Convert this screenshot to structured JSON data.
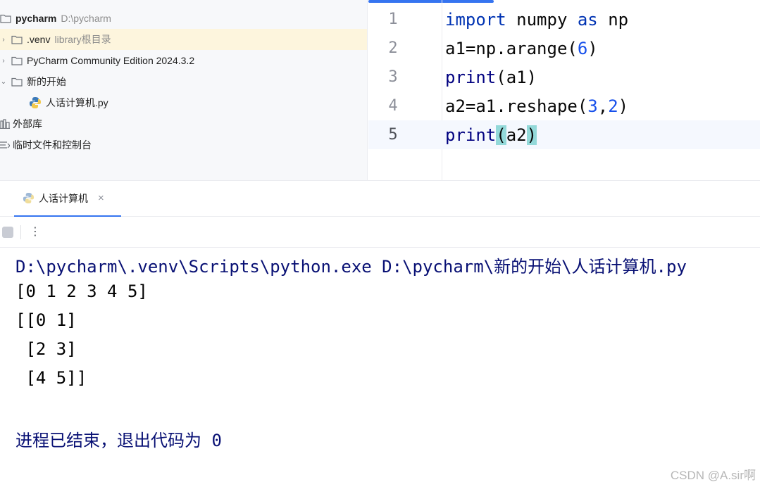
{
  "project": {
    "root_name": "pycharm",
    "root_path": "D:\\pycharm",
    "items": [
      {
        "label": ".venv",
        "hint": "library根目录"
      },
      {
        "label": "PyCharm Community Edition 2024.3.2"
      },
      {
        "label": "新的开始"
      },
      {
        "label": "人话计算机.py"
      },
      {
        "label": "外部库"
      },
      {
        "label": "临时文件和控制台"
      }
    ]
  },
  "editor": {
    "line_numbers": [
      "1",
      "2",
      "3",
      "4",
      "5"
    ],
    "lines": [
      {
        "t1": "import",
        "t2": " numpy ",
        "t3": "as",
        "t4": " np"
      },
      {
        "t1": "a1=np.arange(",
        "t2": "6",
        "t3": ")"
      },
      {
        "t1": "print",
        "t2": "(a1)"
      },
      {
        "t1": "a2=a1.reshape(",
        "t2": "3",
        "t3": ",",
        "t4": "2",
        "t5": ")"
      },
      {
        "t1": "print",
        "t2": "(",
        "t3": "a2",
        "t4": ")"
      }
    ],
    "current_line": 5
  },
  "run": {
    "tab_label": "人话计算机",
    "close_glyph": "×",
    "more_glyph": "⋮"
  },
  "console": {
    "command": "D:\\pycharm\\.venv\\Scripts\\python.exe D:\\pycharm\\新的开始\\人话计算机.py",
    "output": [
      "[0 1 2 3 4 5]",
      "[[0 1]",
      " [2 3]",
      " [4 5]]"
    ],
    "exit_message": "进程已结束，退出代码为 0"
  },
  "watermark": "CSDN @A.sir啊",
  "colors": {
    "accent": "#3574f0",
    "keyword": "#0033b3",
    "number": "#1750eb",
    "console_text": "#081074"
  }
}
